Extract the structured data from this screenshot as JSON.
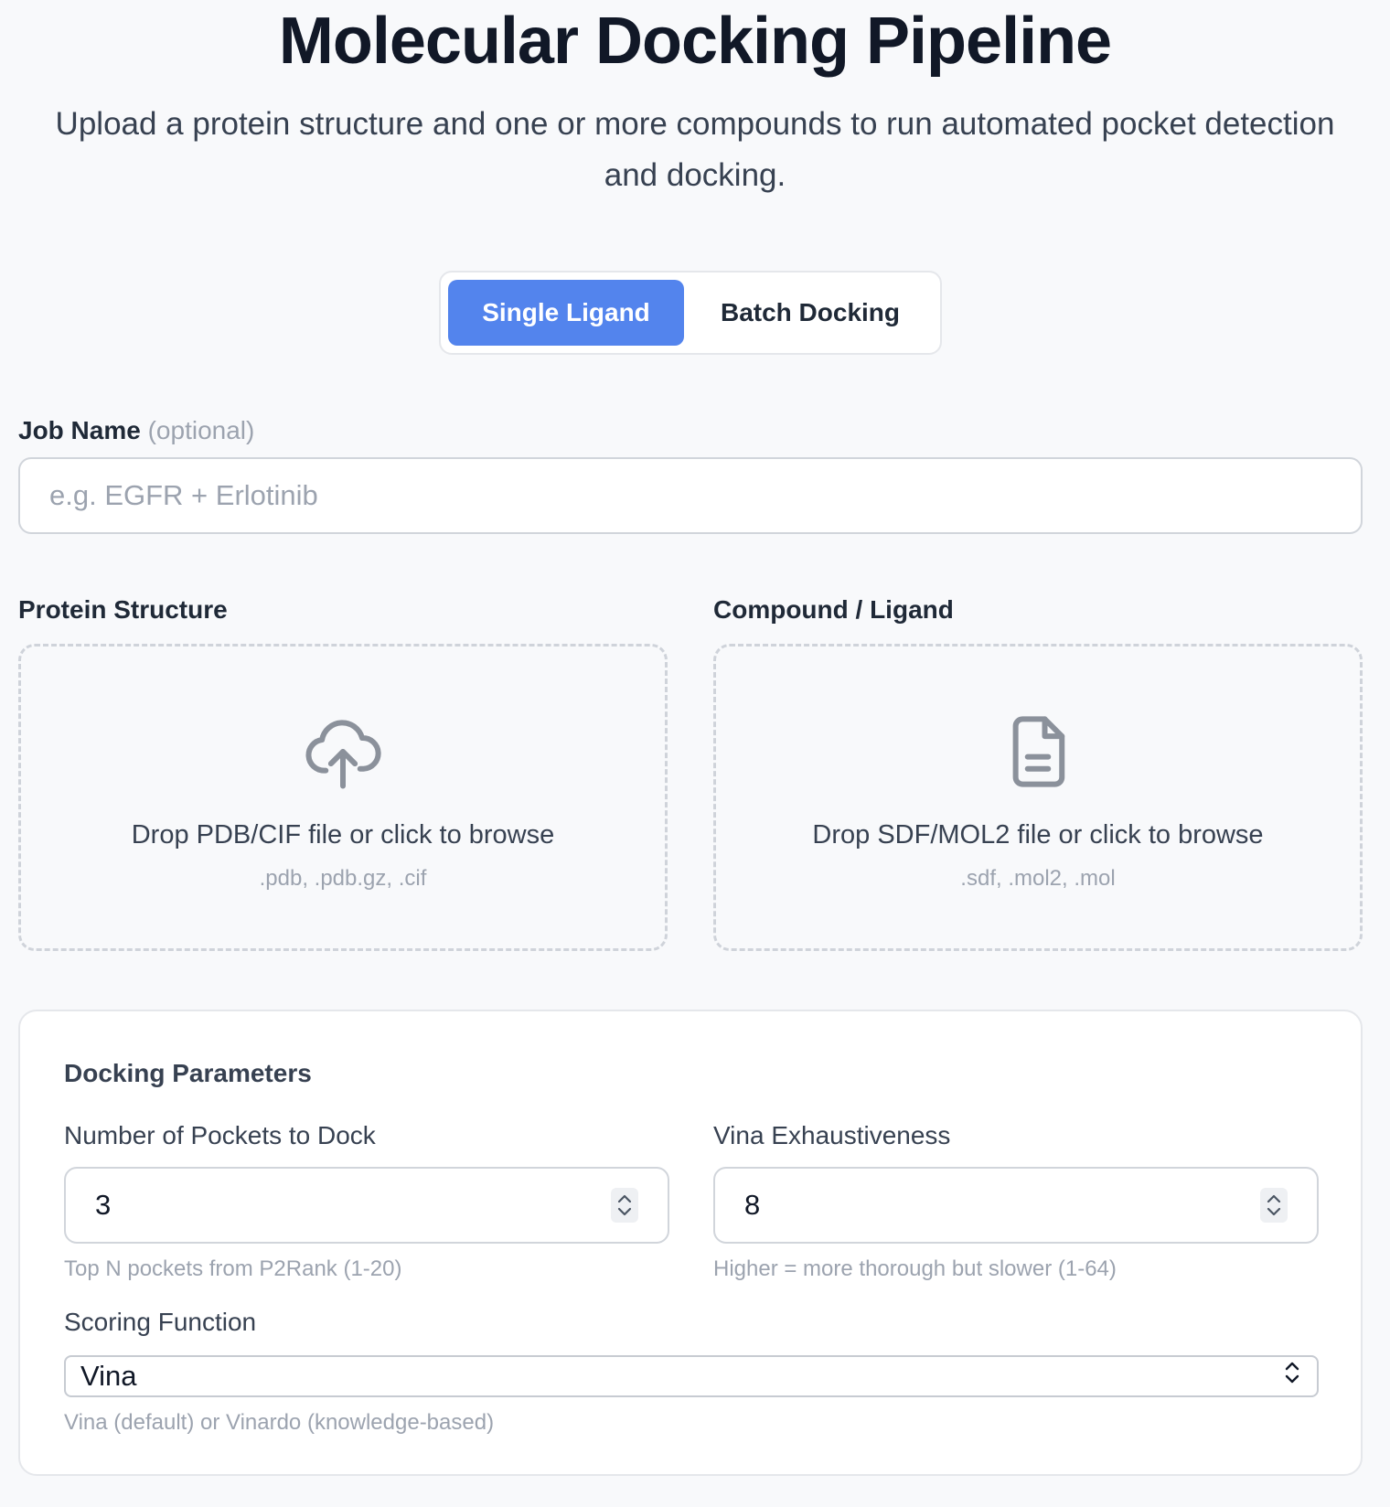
{
  "header": {
    "title": "Molecular Docking Pipeline",
    "subtitle": "Upload a protein structure and one or more compounds to run automated pocket detection and docking."
  },
  "mode_toggle": {
    "options": [
      {
        "label": "Single Ligand",
        "active": true
      },
      {
        "label": "Batch Docking",
        "active": false
      }
    ]
  },
  "job_name": {
    "label": "Job Name",
    "optional_label": "(optional)",
    "placeholder": "e.g. EGFR + Erlotinib",
    "value": ""
  },
  "protein": {
    "label": "Protein Structure",
    "drop_text": "Drop PDB/CIF file or click to browse",
    "formats": ".pdb, .pdb.gz, .cif",
    "icon": "cloud-upload-icon"
  },
  "compound": {
    "label": "Compound / Ligand",
    "drop_text": "Drop SDF/MOL2 file or click to browse",
    "formats": ".sdf, .mol2, .mol",
    "icon": "file-icon"
  },
  "params": {
    "title": "Docking Parameters",
    "pockets": {
      "label": "Number of Pockets to Dock",
      "value": "3",
      "hint": "Top N pockets from P2Rank (1-20)"
    },
    "exhaustiveness": {
      "label": "Vina Exhaustiveness",
      "value": "8",
      "hint": "Higher = more thorough but slower (1-64)"
    },
    "scoring": {
      "label": "Scoring Function",
      "value": "Vina",
      "hint": "Vina (default) or Vinardo (knowledge-based)"
    }
  },
  "colors": {
    "accent": "#5384ed",
    "background": "#f8f9fb",
    "muted_text": "#9ca3af"
  }
}
